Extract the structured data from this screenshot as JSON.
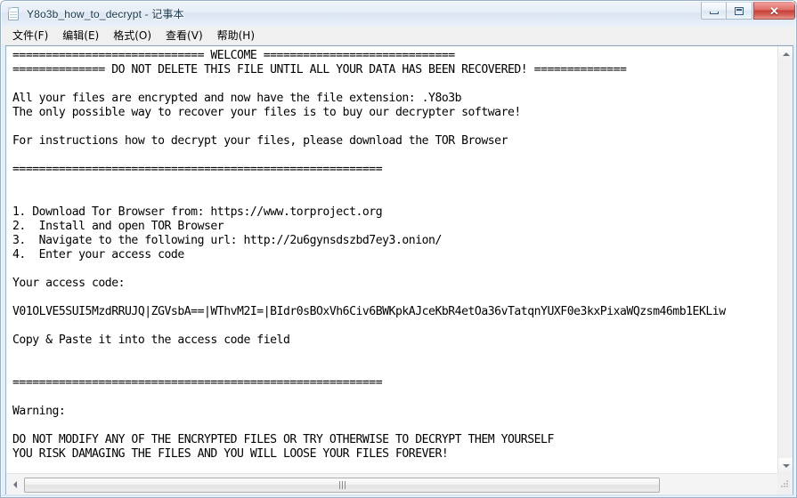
{
  "window": {
    "title": "Y8o3b_how_to_decrypt - 记事本",
    "icon": "notepad-icon",
    "controls": {
      "minimize_label": "–",
      "maximize_label": "□",
      "close_label": "✕"
    }
  },
  "menu": {
    "items": [
      {
        "label": "文件(F)"
      },
      {
        "label": "编辑(E)"
      },
      {
        "label": "格式(O)"
      },
      {
        "label": "查看(V)"
      },
      {
        "label": "帮助(H)"
      }
    ]
  },
  "document": {
    "lines": [
      "============================= WELCOME =============================",
      "============== DO NOT DELETE THIS FILE UNTIL ALL YOUR DATA HAS BEEN RECOVERED! ==============",
      "",
      "All your files are encrypted and now have the file extension: .Y8o3b",
      "The only possible way to recover your files is to buy our decrypter software!",
      "",
      "For instructions how to decrypt your files, please download the TOR Browser",
      "",
      "========================================================",
      "",
      "",
      "1. Download Tor Browser from: https://www.torproject.org",
      "2.  Install and open TOR Browser",
      "3.  Navigate to the following url: http://2u6gynsdszbd7ey3.onion/",
      "4.  Enter your access code",
      "",
      "Your access code:",
      "",
      "V01OLVE5SUI5MzdRRUJQ|ZGVsbA==|WThvM2I=|BIdr0sBOxVh6Civ6BWKpkAJceKbR4etOa36vTatqnYUXF0e3kxPixaWQzsm46mb1EKLiw",
      "",
      "Copy & Paste it into the access code field",
      "",
      "",
      "========================================================",
      "",
      "Warning:",
      "",
      "DO NOT MODIFY ANY OF THE ENCRYPTED FILES OR TRY OTHERWISE TO DECRYPT THEM YOURSELF",
      "YOU RISK DAMAGING THE FILES AND YOU WILL LOOSE YOUR FILES FOREVER!"
    ],
    "text": "============================= WELCOME =============================\n============== DO NOT DELETE THIS FILE UNTIL ALL YOUR DATA HAS BEEN RECOVERED! ==============\n\nAll your files are encrypted and now have the file extension: .Y8o3b\nThe only possible way to recover your files is to buy our decrypter software!\n\nFor instructions how to decrypt your files, please download the TOR Browser\n\n========================================================\n\n\n1. Download Tor Browser from: https://www.torproject.org\n2.  Install and open TOR Browser\n3.  Navigate to the following url: http://2u6gynsdszbd7ey3.onion/\n4.  Enter your access code\n\nYour access code:\n\nV01OLVE5SUI5MzdRRUJQ|ZGVsbA==|WThvM2I=|BIdr0sBOxVh6Civ6BWKpkAJceKbR4etOa36vTatqnYUXF0e3kxPixaWQzsm46mb1EKLiw\n\nCopy & Paste it into the access code field\n\n\n========================================================\n\nWarning:\n\nDO NOT MODIFY ANY OF THE ENCRYPTED FILES OR TRY OTHERWISE TO DECRYPT THEM YOURSELF\nYOU RISK DAMAGING THE FILES AND YOU WILL LOOSE YOUR FILES FOREVER!",
    "file_extension": ".Y8o3b",
    "tor_download_url": "https://www.torproject.org",
    "onion_url": "http://2u6gynsdszbd7ey3.onion/",
    "access_code": "V01OLVE5SUI5MzdRRUJQ|ZGVsbA==|WThvM2I=|BIdr0sBOxVh6Civ6BWKpkAJceKbR4etOa36vTatqnYUXF0e3kxPixaWQzsm46mb1EKLiw"
  },
  "scrollbars": {
    "vertical": {
      "up_arrow": "▲",
      "down_arrow": "▼"
    },
    "horizontal": {
      "left_arrow": "◀",
      "right_arrow": "▶"
    }
  },
  "colors": {
    "titlebar_text": "#17374d",
    "close_button": "#c63f36",
    "window_border": "#9ab3cb",
    "client_background": "#ffffff",
    "text": "#000000"
  }
}
